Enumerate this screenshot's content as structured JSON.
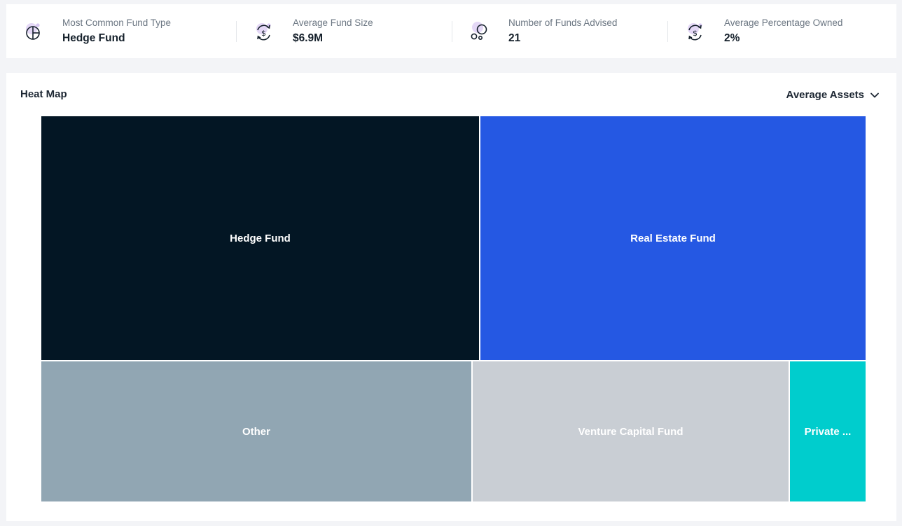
{
  "stats": [
    {
      "label": "Most Common Fund Type",
      "value": "Hedge Fund",
      "icon": "pie-chart-icon"
    },
    {
      "label": "Average Fund Size",
      "value": "$6.9M",
      "icon": "dollar-cycle-icon"
    },
    {
      "label": "Number of Funds Advised",
      "value": "21",
      "icon": "bubbles-icon"
    },
    {
      "label": "Average Percentage Owned",
      "value": "2%",
      "icon": "dollar-cycle-icon"
    }
  ],
  "heatmap": {
    "title": "Heat Map",
    "metric": "Average Assets"
  },
  "colors": {
    "icon_accent": "#d8c8f2",
    "hedge": "#031624",
    "real_estate": "#2558e3",
    "other": "#91a6b3",
    "venture": "#c9ced4",
    "private": "#00cdcd"
  },
  "chart_data": {
    "type": "treemap",
    "items": [
      {
        "label": "Hedge Fund",
        "color": "#031624"
      },
      {
        "label": "Real Estate Fund",
        "color": "#2558e3"
      },
      {
        "label": "Other",
        "color": "#91a6b3"
      },
      {
        "label": "Venture Capital Fund",
        "color": "#c9ced4"
      },
      {
        "label": "Private ...",
        "color": "#00cdcd"
      }
    ]
  }
}
